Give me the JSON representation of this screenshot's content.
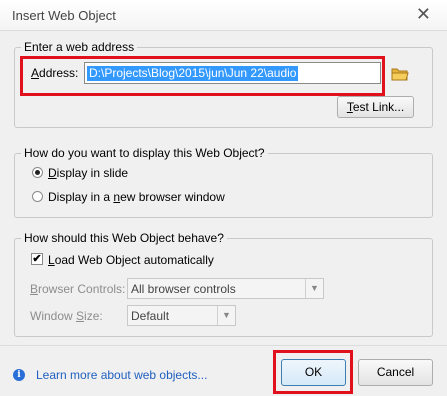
{
  "window": {
    "title": "Insert Web Object",
    "close_glyph": "✕"
  },
  "address_group": {
    "legend": "Enter a web address",
    "address_label_hotkey": "A",
    "address_label_rest": "ddress:",
    "address_value": "D:\\Projects\\Blog\\2015\\jun\\Jun 22\\audio",
    "browse_icon": "folder-icon",
    "test_link_hotkey": "T",
    "test_link_rest": "est Link..."
  },
  "display_group": {
    "legend": "How do you want to display this Web Object?",
    "options": [
      {
        "hotkey": "D",
        "rest": "isplay in slide",
        "selected": true
      },
      {
        "before": "Display in a ",
        "hotkey": "n",
        "after": "ew browser window",
        "selected": false
      }
    ]
  },
  "behave_group": {
    "legend": "How should this Web Object behave?",
    "load_auto": {
      "hotkey": "L",
      "rest": "oad Web Object automatically",
      "checked": true,
      "check_glyph": "✔"
    },
    "browser_controls": {
      "hotkey": "B",
      "rest": "rowser Controls:",
      "value": "All browser controls"
    },
    "window_size": {
      "before": "Window ",
      "hotkey": "S",
      "after": "ize:",
      "value": "Default"
    }
  },
  "footer": {
    "info_icon": "info-icon",
    "info_glyph": "i",
    "learn_more": "Learn more about web objects...",
    "ok_label": "OK",
    "cancel_label": "Cancel"
  },
  "highlight_color": "#e0101c",
  "selection_color": "#3399ff"
}
